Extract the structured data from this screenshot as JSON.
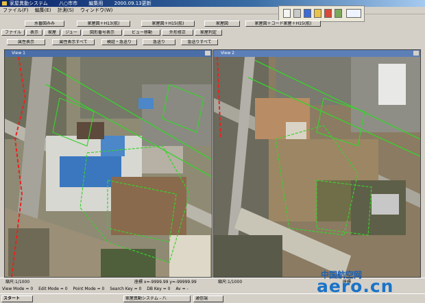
{
  "window": {
    "title_parts": [
      "家屋異動システム",
      "八○市市",
      "編集用",
      "2000.09.13更新"
    ]
  },
  "menu": [
    "ファイル(F)",
    "編集(E)",
    "計測(S)",
    "ウィンドウ(W)"
  ],
  "toolbar_row1": [
    "水番図みみ",
    "家屋図＋H13(航)",
    "家屋図＋H15(航)",
    "家屋図",
    "家屋図＋コード家屋＋H15(航)"
  ],
  "toolbar_row2": [
    "ファイル",
    "表示",
    "家屋",
    "ジュー",
    "図形番号表示",
    "ビュー移動",
    "外形修正",
    "家屋判定"
  ],
  "toolbar_row3": [
    "属性表示",
    "属性表示すべて",
    "検証・急送り",
    "急送り",
    "急送りすべて"
  ],
  "views": {
    "left_title": "View 1",
    "right_title": "View 2",
    "left_scale": "縮尺:1/1000",
    "right_scale": "縮尺:1/1000",
    "left_coord": "座標 x=-9999.99 y=-99999.99",
    "right_coord": "座標"
  },
  "infobar": [
    "View Mode = 0",
    "Edit Mode = 0",
    "Point Mode = 0",
    "Search Key = 0",
    "DB Key = 0",
    "Av = -"
  ],
  "taskbar": {
    "start": "スタート",
    "task1": "家屋異動システム - 八",
    "task2": "通信端"
  },
  "watermark": {
    "cn": "中国航空网",
    "latin": "aero.cn"
  },
  "colors": {
    "titlebar": "#0a246a",
    "accent_green": "#39d12e",
    "accent_red": "#e8231e"
  },
  "icons": [
    "app-icon",
    "font-icon",
    "print-icon",
    "save-icon",
    "map-icon",
    "color-icon",
    "data-icon"
  ]
}
